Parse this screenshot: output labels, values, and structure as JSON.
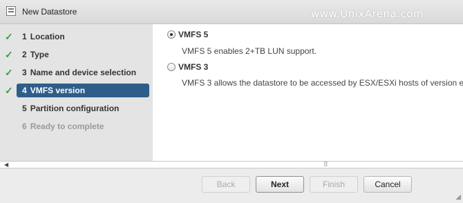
{
  "window": {
    "title": "New Datastore",
    "icon": "datastore-icon",
    "watermark": "www.UnixArena.com"
  },
  "sidebar": {
    "steps": [
      {
        "num": "1",
        "label": "Location",
        "status": "done"
      },
      {
        "num": "2",
        "label": "Type",
        "status": "done"
      },
      {
        "num": "3",
        "label": "Name and device selection",
        "status": "done"
      },
      {
        "num": "4",
        "label": "VMFS version",
        "status": "active"
      },
      {
        "num": "5",
        "label": "Partition configuration",
        "status": "pending"
      },
      {
        "num": "6",
        "label": "Ready to complete",
        "status": "disabled"
      }
    ]
  },
  "content": {
    "options": [
      {
        "label": "VMFS 5",
        "description": "VMFS 5 enables 2+TB LUN support.",
        "selected": true
      },
      {
        "label": "VMFS 3",
        "description": "VMFS 3 allows the datastore to be accessed by ESX/ESXi hosts of version e",
        "selected": false
      }
    ]
  },
  "footer": {
    "back_label": "Back",
    "next_label": "Next",
    "finish_label": "Finish",
    "cancel_label": "Cancel"
  },
  "colors": {
    "active_step": "#2e5d8a",
    "check": "#36a23c"
  }
}
